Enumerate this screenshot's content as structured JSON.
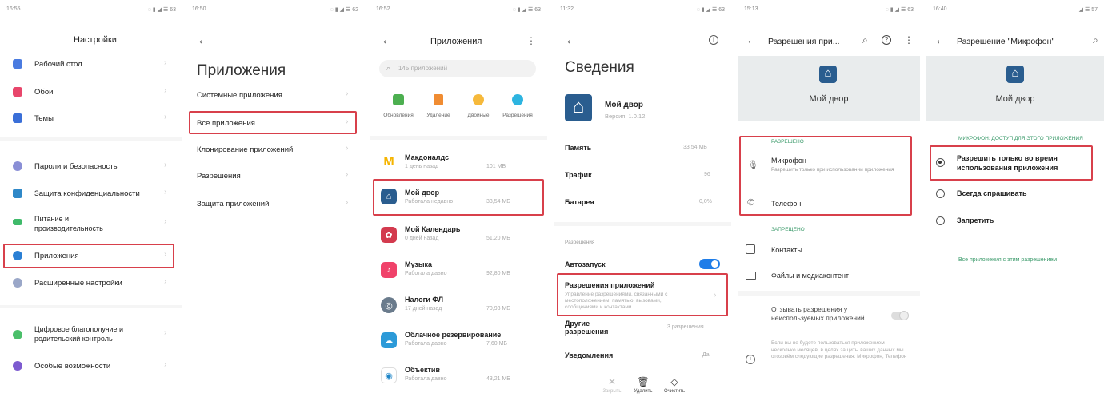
{
  "s1": {
    "time": "16:55",
    "title": "Настройки",
    "items": [
      "Рабочий стол",
      "Обои",
      "Темы",
      "Пароли и безопасность",
      "Защита конфиденциальности",
      "Питание и\nпроизводительность",
      "Приложения",
      "Расширенные настройки",
      "Цифровое благополучие и\nродительский контроль",
      "Особые возможности"
    ],
    "colors": {
      "highlight": "#d8404b"
    }
  },
  "s2": {
    "time": "16:50",
    "back": "←",
    "title": "Приложения",
    "items": [
      "Системные приложения",
      "Все приложения",
      "Клонирование приложений",
      "Разрешения",
      "Защита приложений"
    ]
  },
  "s3": {
    "time": "16:52",
    "title": "Приложения",
    "search_placeholder": "145 приложений",
    "actions": [
      "Обновления",
      "Удаление",
      "Двойные",
      "Разрешения"
    ],
    "apps": [
      {
        "name": "Макдоналдс",
        "status": "1 день назад",
        "size": "101 МБ",
        "icon": "M",
        "color": "#f5c518"
      },
      {
        "name": "Мой двор",
        "status": "Работала недавно",
        "size": "33,54 МБ",
        "icon": "⌂",
        "color": "#2a5d8f"
      },
      {
        "name": "Мой Календарь",
        "status": "0 дней назад",
        "size": "51,20 МБ",
        "icon": "✿",
        "color": "#d33a4e"
      },
      {
        "name": "Музыка",
        "status": "Работала давно",
        "size": "92,80 МБ",
        "icon": "♪",
        "color": "#f0426a"
      },
      {
        "name": "Налоги ФЛ",
        "status": "17 дней назад",
        "size": "70,93 МБ",
        "icon": "◎",
        "color": "#6a7b8c"
      },
      {
        "name": "Облачное резервирование",
        "status": "Работала давно",
        "size": "7,60 МБ",
        "icon": "☁",
        "color": "#2c9ad8"
      },
      {
        "name": "Объектив",
        "status": "Работала давно",
        "size": "43,21 МБ",
        "icon": "◉",
        "color": "#ffffff"
      }
    ]
  },
  "s4": {
    "time": "11:32",
    "title": "Сведения",
    "app_name": "Мой двор",
    "version": "Версия: 1.0.12",
    "rows": [
      {
        "label": "Память",
        "value": "33,54 МБ"
      },
      {
        "label": "Трафик",
        "value": "96"
      },
      {
        "label": "Батарея",
        "value": "0,0%"
      }
    ],
    "perm_section": "Разрешения",
    "autostart": "Автозапуск",
    "app_perms_title": "Разрешения приложений",
    "app_perms_desc": "Управление разрешениями, связанными с местоположением, памятью, вызовами, сообщениями и контактами",
    "other_perms": "Другие\nразрешения",
    "other_perms_value": "3 разрешения",
    "notifications": "Уведомления",
    "notifications_value": "Да",
    "bottom": [
      "Закрыть",
      "Удалить",
      "Очистить"
    ]
  },
  "s5": {
    "time": "15:13",
    "title": "Разрешения при...",
    "app_name": "Мой двор",
    "allowed": "РАЗРЕШЕНО",
    "mic": "Микрофон",
    "mic_desc": "Разрешить только при использовании приложения",
    "phone": "Телефон",
    "denied": "ЗАПРЕЩЕНО",
    "contacts": "Контакты",
    "files": "Файлы и медиаконтент",
    "revoke": "Отзывать разрешения у\nнеиспользуемых приложений",
    "info": "Если вы не будете пользоваться приложением несколько месяцев, в целях защиты ваших данных мы отозовём следующие разрешения: Микрофон, Телефон"
  },
  "s6": {
    "time": "16:40",
    "title": "Разрешение \"Микрофон\"",
    "app_name": "Мой двор",
    "section": "МИКРОФОН: ДОСТУП ДЛЯ ЭТОГО ПРИЛОЖЕНИЯ",
    "options": [
      "Разрешить только во время\nиспользования приложения",
      "Всегда спрашивать",
      "Запретить"
    ],
    "link": "Все приложения с этим разрешением"
  }
}
